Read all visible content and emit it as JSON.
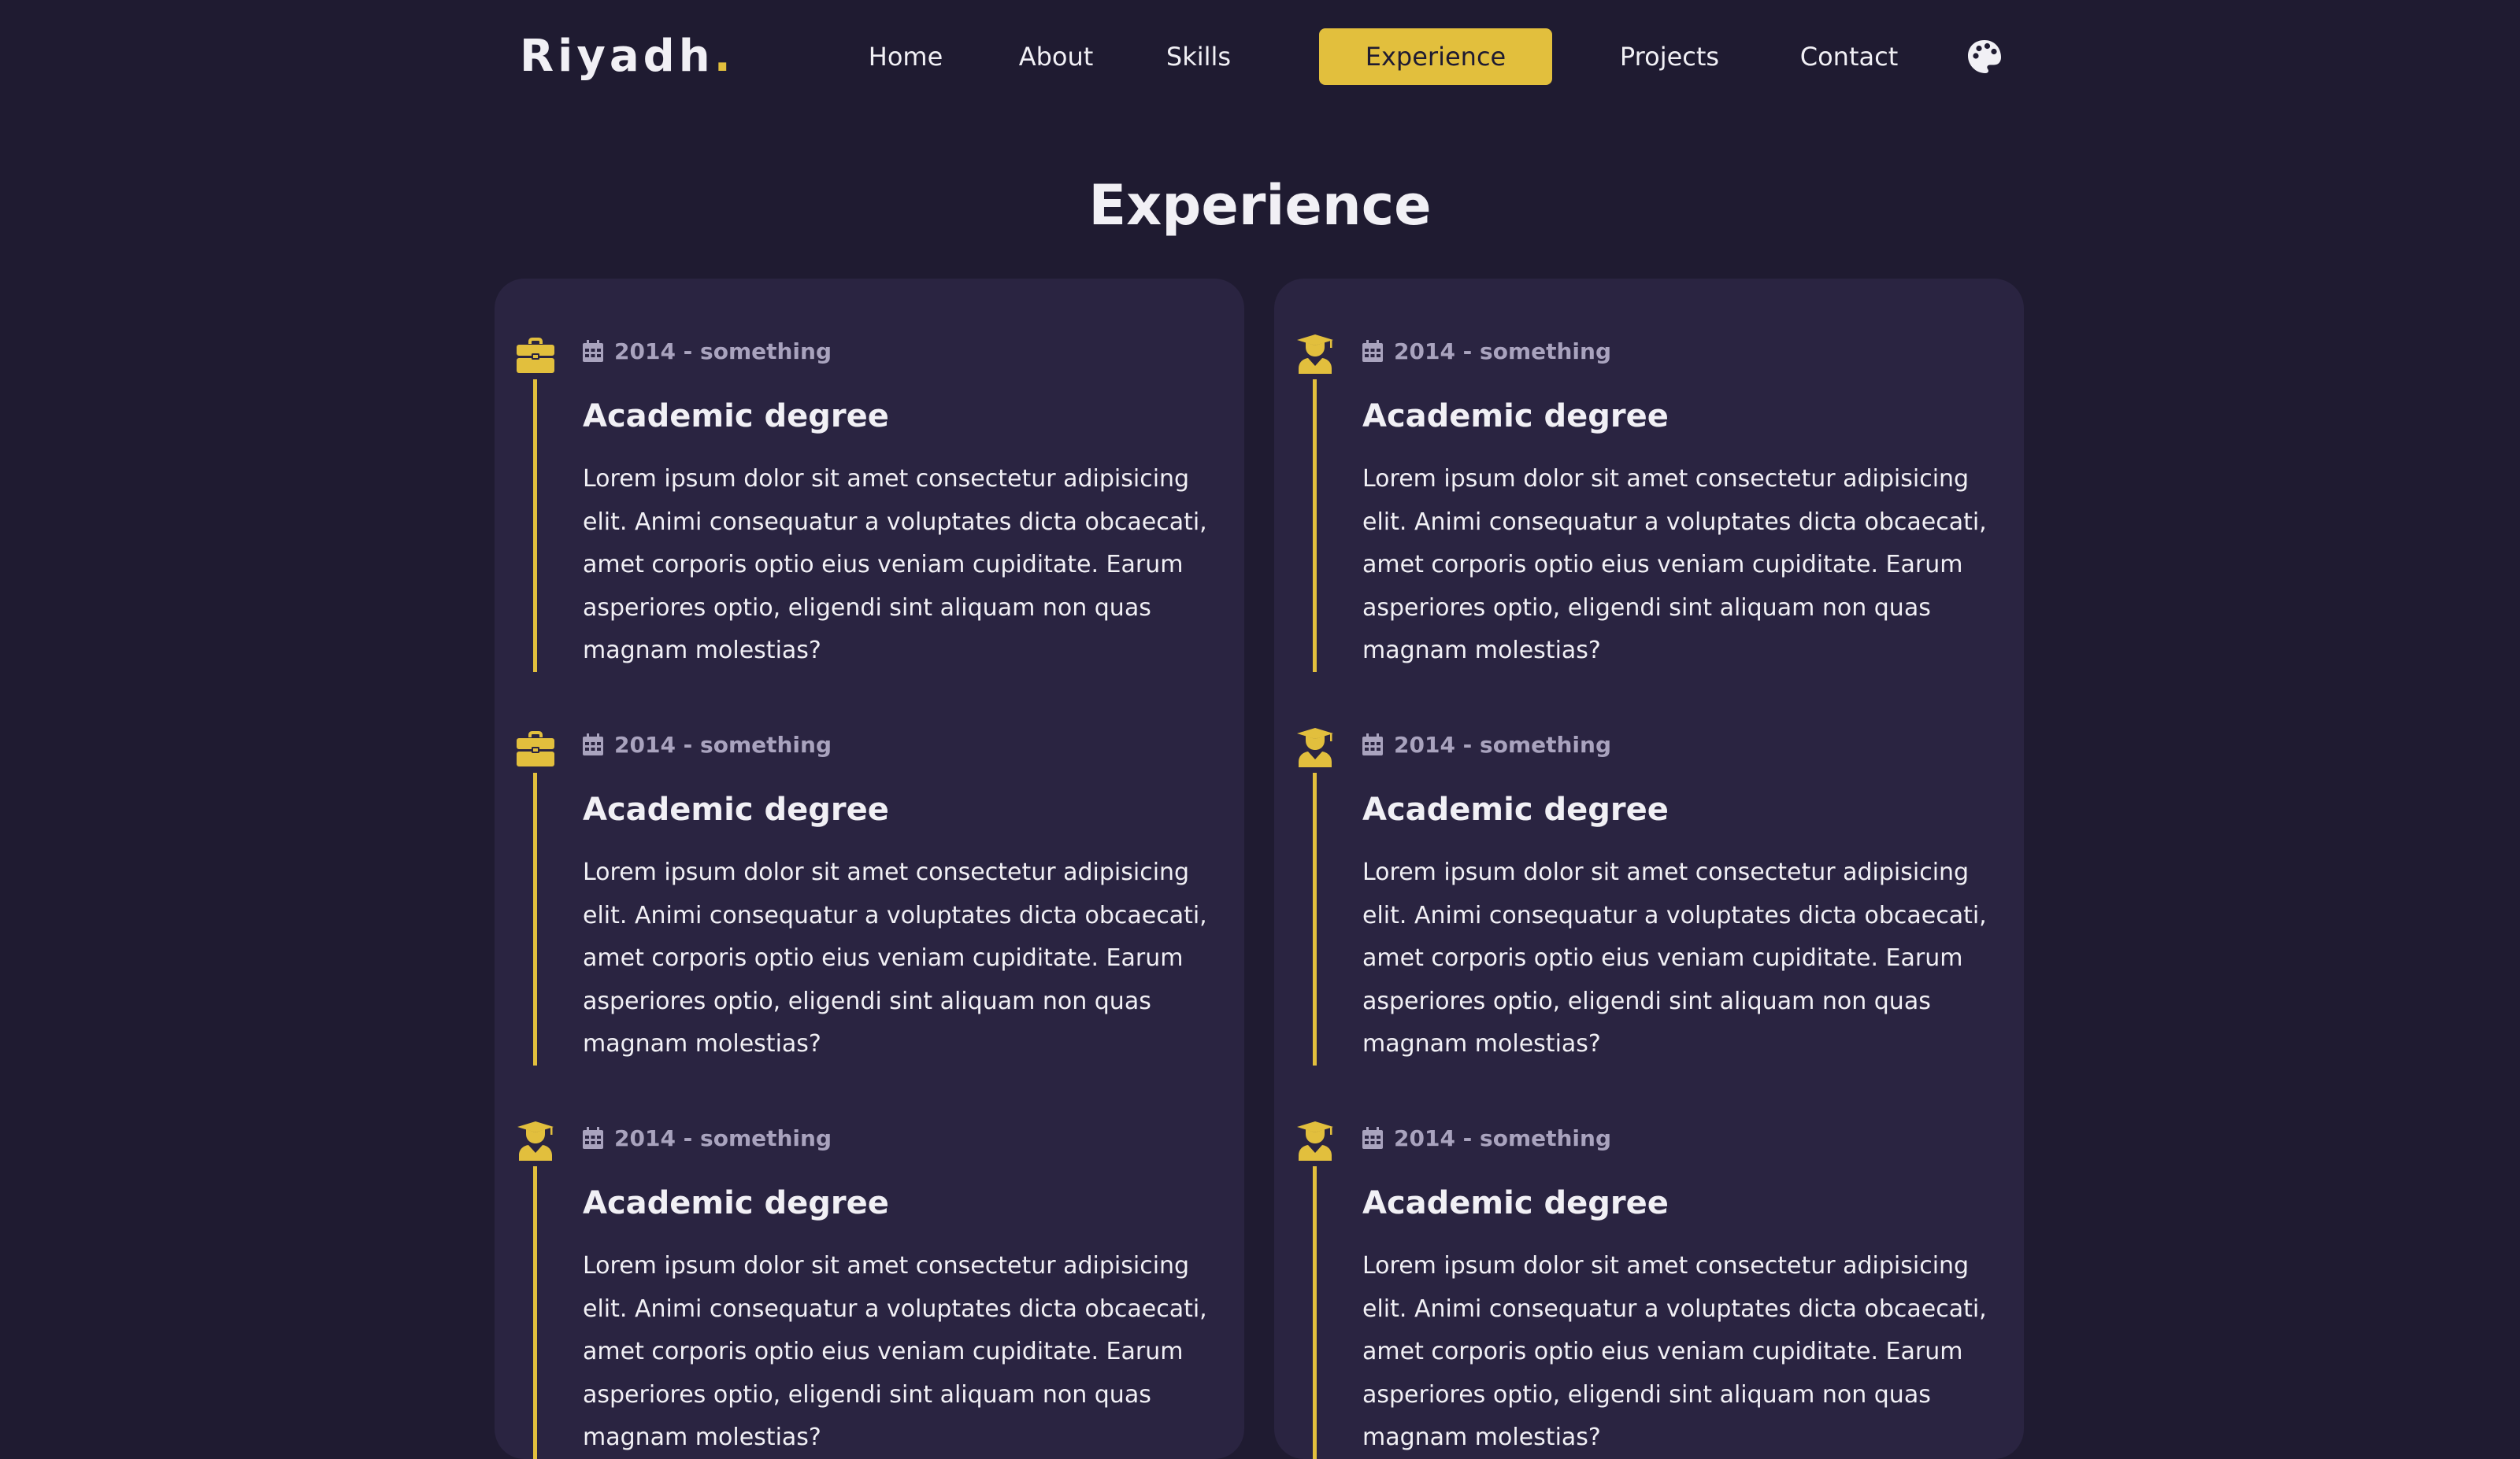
{
  "header": {
    "logo_text": "Riyadh",
    "logo_dot": ".",
    "nav": [
      {
        "label": "Home"
      },
      {
        "label": "About"
      },
      {
        "label": "Skills"
      },
      {
        "label": "Experience",
        "active": true
      },
      {
        "label": "Projects"
      },
      {
        "label": "Contact"
      }
    ],
    "theme_icon": "palette-icon"
  },
  "page": {
    "title": "Experience"
  },
  "columns": [
    {
      "items": [
        {
          "icon": "briefcase-icon",
          "date": "2014 - something",
          "title": "Academic degree",
          "text": "Lorem ipsum dolor sit amet consectetur adipisicing elit. Animi consequatur a voluptates dicta obcaecati, amet corporis optio eius veniam cupiditate. Earum asperiores optio, eligendi sint aliquam non quas magnam molestias?"
        },
        {
          "icon": "briefcase-icon",
          "date": "2014 - something",
          "title": "Academic degree",
          "text": "Lorem ipsum dolor sit amet consectetur adipisicing elit. Animi consequatur a voluptates dicta obcaecati, amet corporis optio eius veniam cupiditate. Earum asperiores optio, eligendi sint aliquam non quas magnam molestias?"
        },
        {
          "icon": "graduate-icon",
          "date": "2014 - something",
          "title": "Academic degree",
          "text": "Lorem ipsum dolor sit amet consectetur adipisicing elit. Animi consequatur a voluptates dicta obcaecati, amet corporis optio eius veniam cupiditate. Earum asperiores optio, eligendi sint aliquam non quas magnam molestias?"
        }
      ]
    },
    {
      "items": [
        {
          "icon": "graduate-icon",
          "date": "2014 - something",
          "title": "Academic degree",
          "text": "Lorem ipsum dolor sit amet consectetur adipisicing elit. Animi consequatur a voluptates dicta obcaecati, amet corporis optio eius veniam cupiditate. Earum asperiores optio, eligendi sint aliquam non quas magnam molestias?"
        },
        {
          "icon": "graduate-icon",
          "date": "2014 - something",
          "title": "Academic degree",
          "text": "Lorem ipsum dolor sit amet consectetur adipisicing elit. Animi consequatur a voluptates dicta obcaecati, amet corporis optio eius veniam cupiditate. Earum asperiores optio, eligendi sint aliquam non quas magnam molestias?"
        },
        {
          "icon": "graduate-icon",
          "date": "2014 - something",
          "title": "Academic degree",
          "text": "Lorem ipsum dolor sit amet consectetur adipisicing elit. Animi consequatur a voluptates dicta obcaecati, amet corporis optio eius veniam cupiditate. Earum asperiores optio, eligendi sint aliquam non quas magnam molestias?"
        }
      ]
    }
  ],
  "colors": {
    "background": "#1f1b31",
    "card": "#2a2441",
    "accent": "#e2bf3d",
    "text": "#f1f0f5",
    "muted": "#a9a3be"
  },
  "icons": {
    "date": "calendar-icon"
  }
}
